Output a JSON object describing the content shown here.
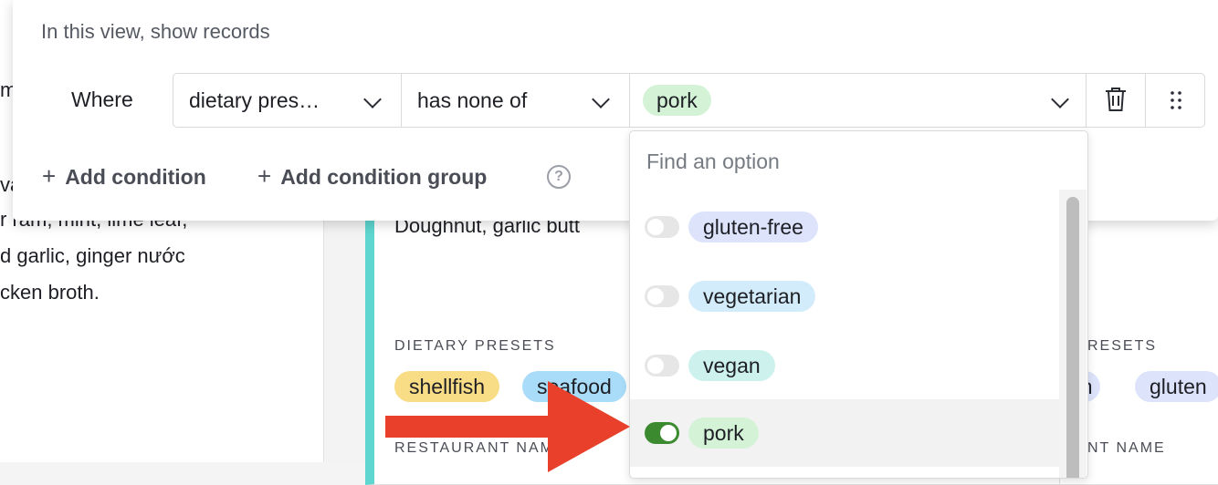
{
  "background": {
    "left_fragments": [
      "m",
      "va",
      "r răm, mint, lime leaf,",
      "d garlic, ginger nước",
      "cken broth."
    ],
    "card_text": "Doughnut, garlic butt",
    "dietary_label": "DIETARY PRESETS",
    "dietary_label_right": "RESETS",
    "restaurant_label": "RESTAURANT NAME",
    "restaurant_label_right": "NT NAME",
    "card_tags": [
      "shellfish",
      "seafood"
    ],
    "card_tags_right": [
      "an",
      "gluten"
    ]
  },
  "filter": {
    "heading": "In this view, show records",
    "where_label": "Where",
    "field": "dietary pres…",
    "operator": "has none of",
    "value_chip": "pork",
    "add_condition": "Add condition",
    "add_condition_group": "Add condition group",
    "help": "?"
  },
  "dropdown": {
    "search_placeholder": "Find an option",
    "options": [
      {
        "label": "gluten-free",
        "checked": false,
        "color": "#dde3fb"
      },
      {
        "label": "vegetarian",
        "checked": false,
        "color": "#d3ecfb"
      },
      {
        "label": "vegan",
        "checked": false,
        "color": "#cdf2ee"
      },
      {
        "label": "pork",
        "checked": true,
        "color": "#d4f3d6"
      }
    ]
  },
  "colors": {
    "accent_toggle_on": "#3b8a30",
    "annotation_arrow": "#e8402a",
    "card_stripe": "#5fd6cf",
    "tag_shellfish": "#f9dc86",
    "tag_seafood": "#a9dcf8"
  },
  "icons": [
    "plus-icon",
    "chevron-down-icon",
    "trash-icon",
    "drag-handle-icon",
    "help-icon"
  ]
}
